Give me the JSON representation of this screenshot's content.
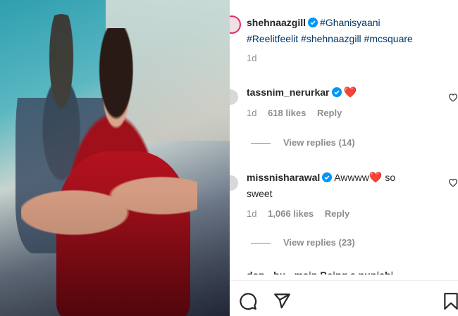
{
  "post": {
    "author": "shehnaazgill",
    "caption_tags_line1": "#Ghanisyaani",
    "caption_tags_line2": "#Reelitfeelit #shehnaazgill #mcsquare",
    "age": "1d"
  },
  "comments": [
    {
      "username": "tassnim_nerurkar",
      "text": "",
      "emoji": "❤️",
      "age": "1d",
      "likes": "618 likes",
      "reply_label": "Reply",
      "view_replies": "View replies (14)"
    },
    {
      "username": "missnisharawal",
      "text_before": "Awwww",
      "emoji": "❤️",
      "text_after": " so",
      "text_line2": "sweet",
      "age": "1d",
      "likes": "1,066 likes",
      "reply_label": "Reply",
      "view_replies": "View replies (23)"
    }
  ],
  "partial_next_comment": "dop · bu · main Being a punjabi",
  "colors": {
    "verified": "#0095f6",
    "heart": "#ed1c24",
    "hashtag": "#00376b",
    "muted": "#8e8e8e"
  },
  "icons": [
    "comment-icon",
    "share-icon",
    "bookmark-icon",
    "verified-badge-icon",
    "heart-outline-icon"
  ]
}
